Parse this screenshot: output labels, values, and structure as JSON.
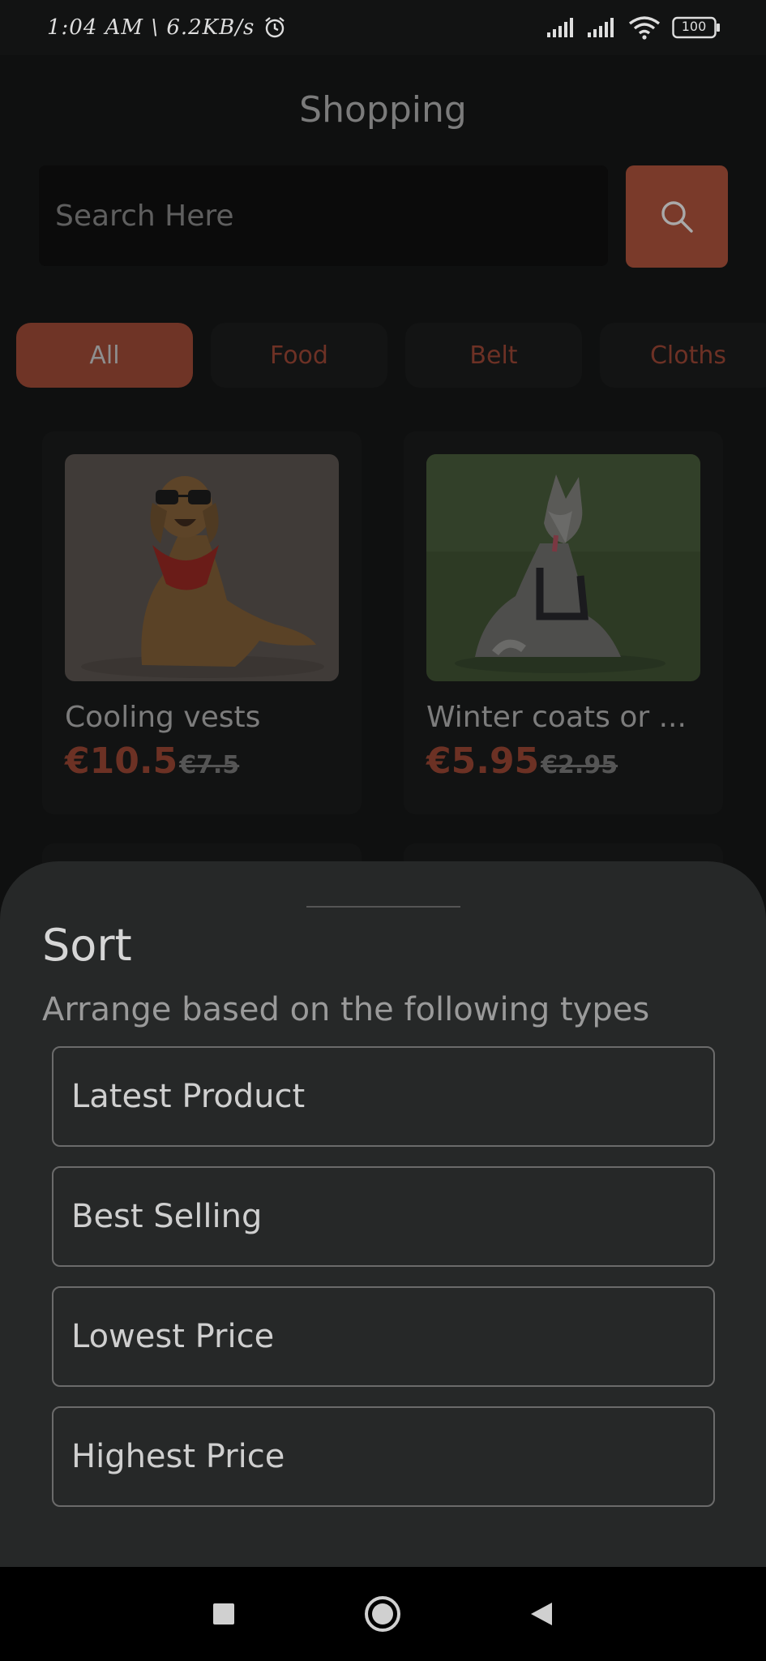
{
  "status_bar": {
    "time": "1:04 AM \\ 6.2KB/s",
    "battery": "100"
  },
  "header": {
    "title": "Shopping"
  },
  "search": {
    "placeholder": "Search Here"
  },
  "categories": [
    {
      "label": "All",
      "active": true
    },
    {
      "label": "Food",
      "active": false
    },
    {
      "label": "Belt",
      "active": false
    },
    {
      "label": "Cloths",
      "active": false
    }
  ],
  "products": [
    {
      "title": "Cooling vests",
      "price": "€10.5",
      "old_price": "€7.5"
    },
    {
      "title": "Winter coats or ...",
      "price": "€5.95",
      "old_price": "€2.95"
    }
  ],
  "sort_sheet": {
    "title": "Sort",
    "subtitle": "Arrange based on the following types",
    "options": [
      {
        "label": "Latest Product"
      },
      {
        "label": "Best Selling"
      },
      {
        "label": "Lowest Price"
      },
      {
        "label": "Highest Price"
      }
    ]
  },
  "colors": {
    "accent": "#7a3a2a",
    "sheet_bg": "#262828",
    "background": "#0f1010"
  }
}
